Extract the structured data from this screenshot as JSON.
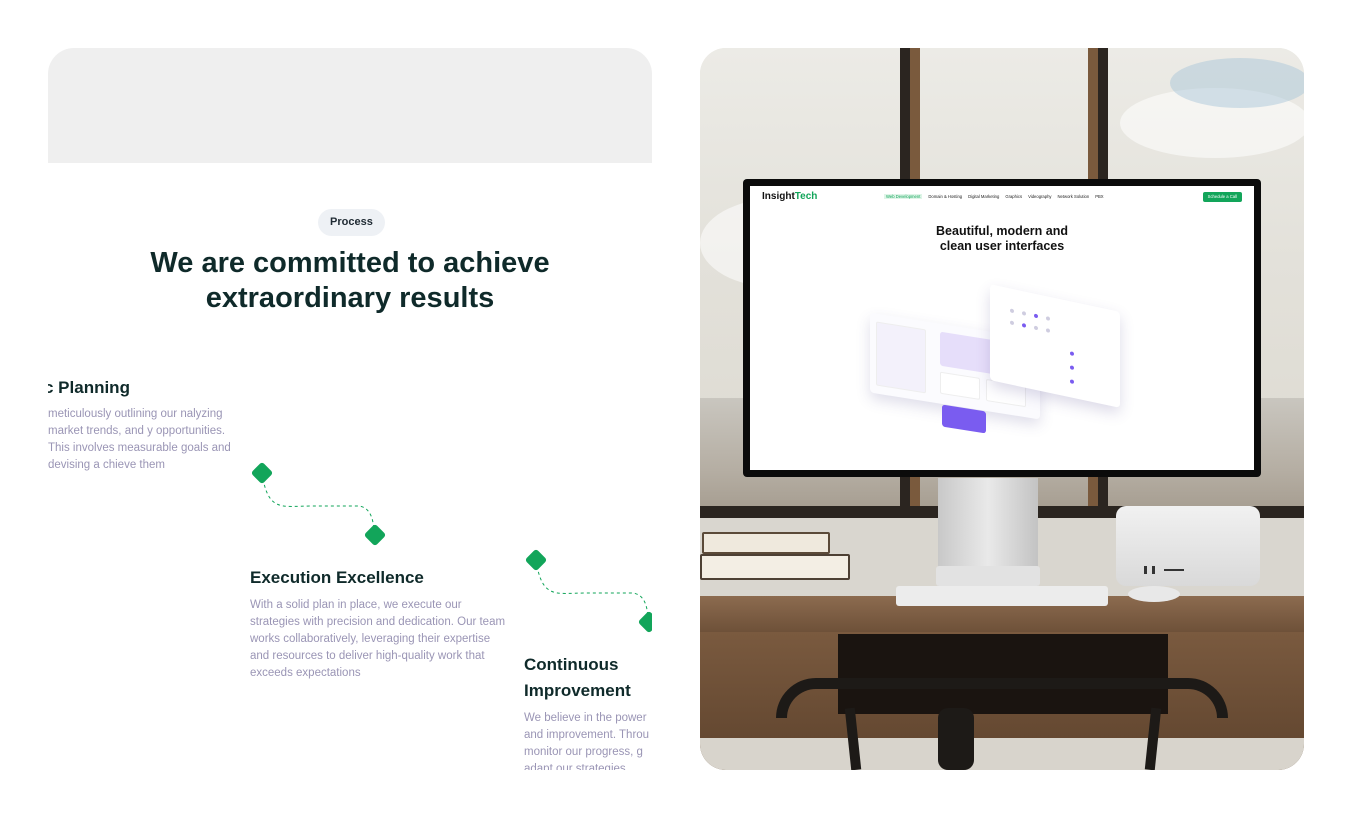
{
  "process": {
    "pill_label": "Process",
    "heading": "We are committed to achieve extraordinary results",
    "steps": [
      {
        "title": "c Planning",
        "description": "meticulously outlining our nalyzing market trends, and y opportunities. This involves measurable goals and devising a chieve them"
      },
      {
        "title": "Execution Excellence",
        "description": "With a solid plan in place, we execute our strategies with precision and dedication. Our team works collaboratively, leveraging their expertise and resources to deliver high-quality work that exceeds expectations"
      },
      {
        "title": "Continuous Improvement",
        "description": "We believe in the power and improvement. Throu monitor our progress, g adapt our strategies"
      }
    ],
    "accent_color": "#12a55a"
  },
  "mockup": {
    "logo_main": "Insight",
    "logo_accent": "Tech",
    "nav_links": [
      "Web Development",
      "Domain & Hosting",
      "Digital Marketing",
      "Graphics",
      "Videography",
      "Network Solution",
      "PBX"
    ],
    "cta_label": "Schedule a Call",
    "heading_line1": "Beautiful, modern and",
    "heading_line2": "clean user interfaces"
  }
}
